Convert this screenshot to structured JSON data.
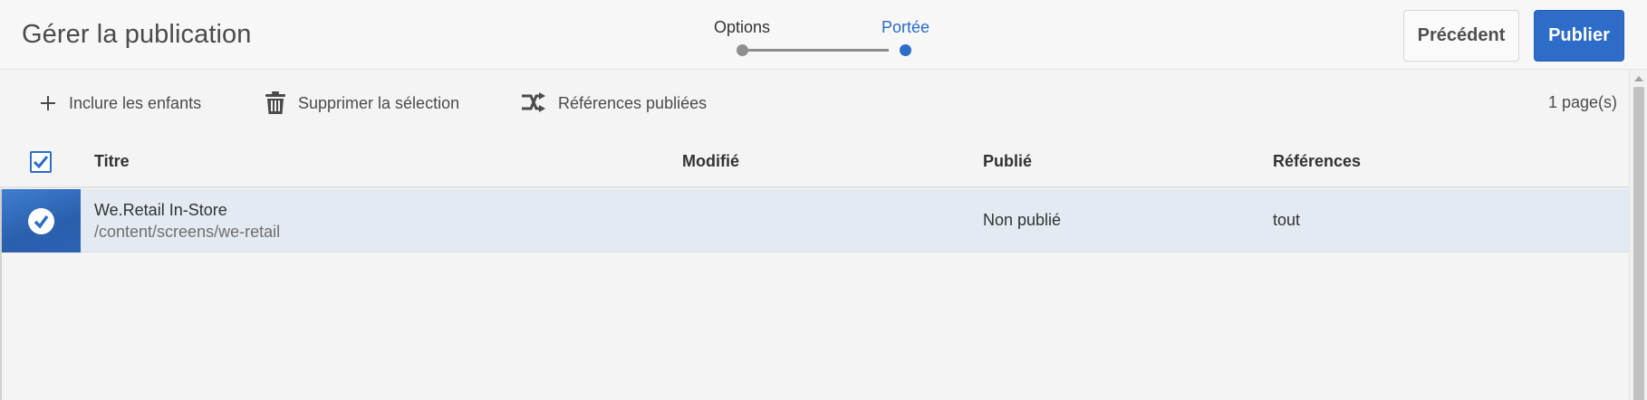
{
  "header": {
    "title": "Gérer la publication",
    "steps": [
      {
        "label": "Options",
        "state": "done"
      },
      {
        "label": "Portée",
        "state": "active"
      }
    ],
    "prev_label": "Précédent",
    "publish_label": "Publier"
  },
  "toolbar": {
    "include_children": {
      "label": "Inclure les enfants",
      "icon": "plus-icon"
    },
    "delete_selection": {
      "label": "Supprimer la sélection",
      "icon": "trash-icon"
    },
    "published_refs": {
      "label": "Références publiées",
      "icon": "references-icon"
    },
    "count": "1 page(s)"
  },
  "table": {
    "columns": [
      "Titre",
      "Modifié",
      "Publié",
      "Références"
    ],
    "rows": [
      {
        "title": "We.Retail In-Store",
        "path": "/content/screens/we-retail",
        "modified": "",
        "published": "Non publié",
        "references": "tout",
        "selected": true
      }
    ]
  },
  "colors": {
    "accent": "#2d6cc8",
    "row_selected": "#e4eaf2",
    "background": "#f4f4f4"
  }
}
